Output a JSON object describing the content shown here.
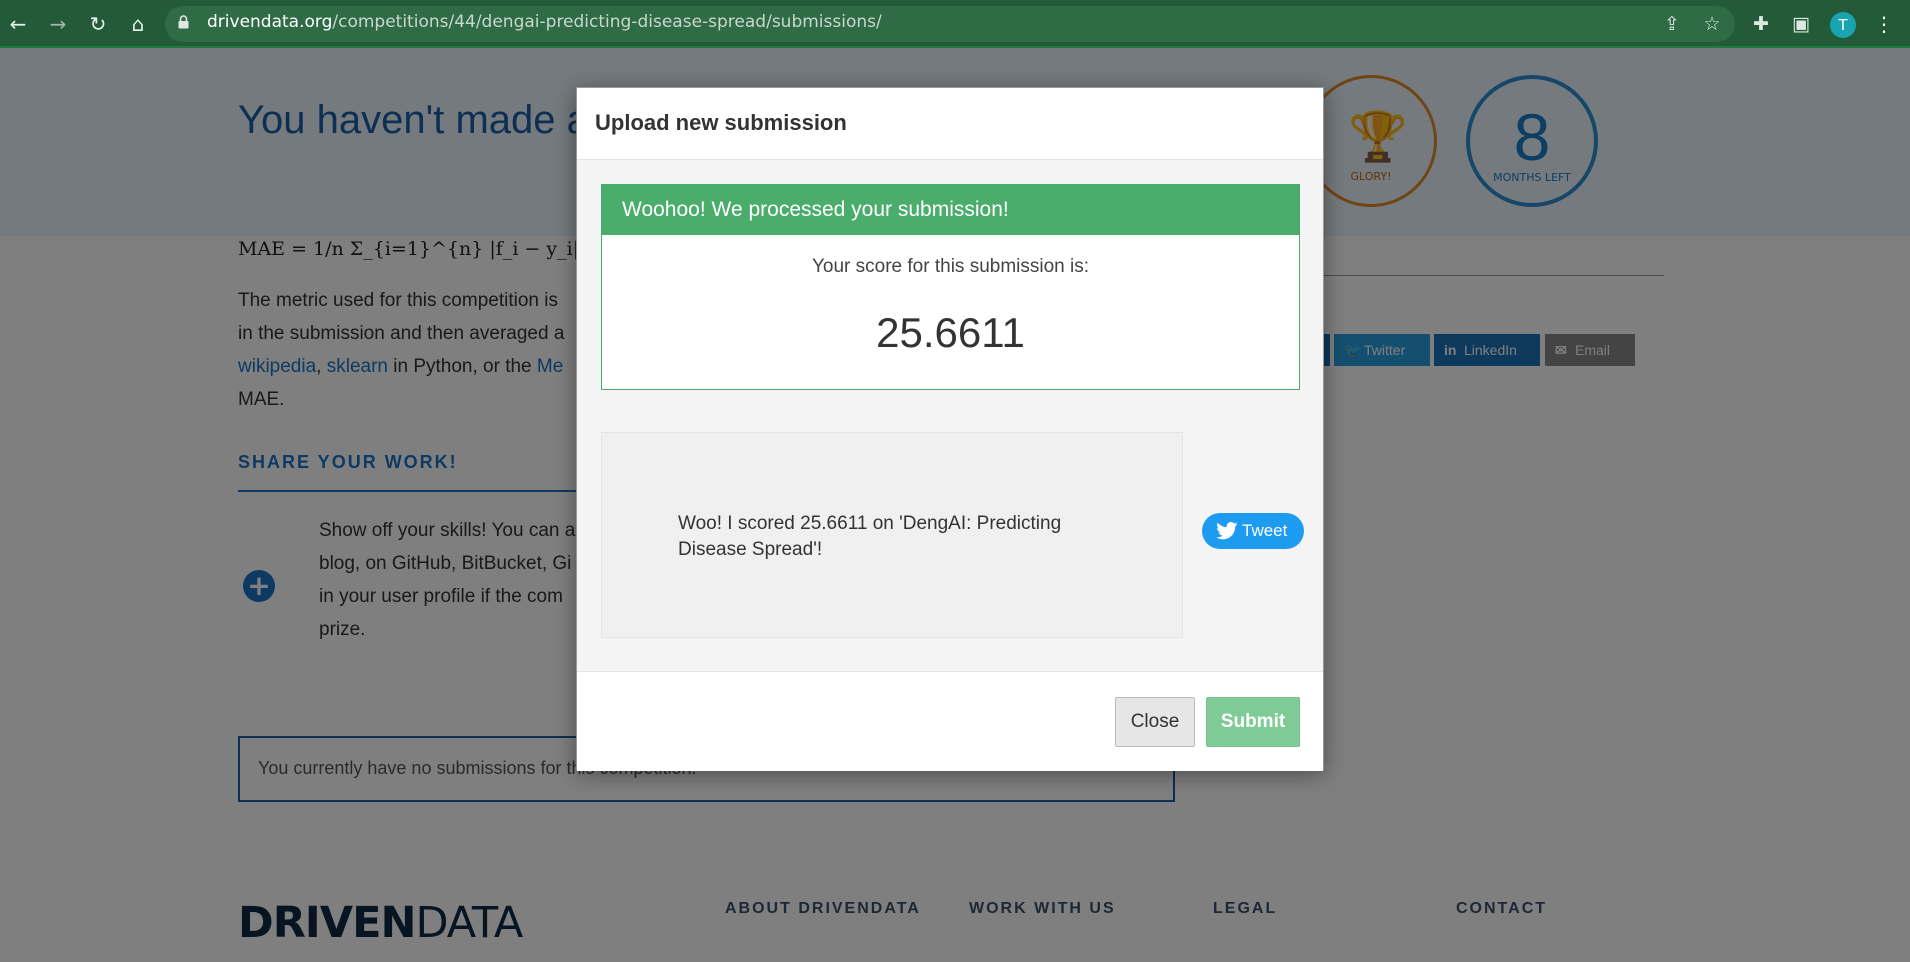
{
  "browser": {
    "url_host": "drivendata.org",
    "url_path": "/competitions/44/dengai-predicting-disease-spread/submissions/",
    "avatar_letter": "T"
  },
  "page": {
    "hero_title": "You haven't made a submission yet. Surely you can do better than that.",
    "hero_title_visible": "You haven't made a do better than that",
    "badge_glory_label": "GLORY!",
    "badge_months_number": "8",
    "badge_months_label": "MONTHS LEFT",
    "formula": "MAE = 1/n Σ_{i=1}^{n} |f_i − y_i|",
    "body_line1": "The metric used for this competition is",
    "body_line2": "in the submission and then averaged a",
    "body_link_wikipedia": "wikipedia",
    "body_link_sklearn": "sklearn",
    "body_line3_mid": " in Python, or the ",
    "body_link_metrics": "Me",
    "body_line4": "MAE.",
    "share_heading": "SHARE YOUR WORK!",
    "share_line1": "Show off your skills! You can a",
    "share_line2": "blog, on GitHub, BitBucket, Gi",
    "share_line3": "in your user profile if the com",
    "share_line4": "prize.",
    "social_twitter": "Twitter",
    "social_linkedin": "LinkedIn",
    "social_email": "Email",
    "no_submissions": "You currently have no submissions for this competition.",
    "footer_logo_driven": "DRIVEN",
    "footer_logo_data": "DATA",
    "footer_links": [
      "ABOUT DRIVENDATA",
      "WORK WITH US",
      "LEGAL",
      "CONTACT"
    ]
  },
  "modal": {
    "title": "Upload new submission",
    "success_heading": "Woohoo! We processed your submission!",
    "score_label": "Your score for this submission is:",
    "score_value": "25.6611",
    "tweet_text": "Woo! I scored 25.6611 on 'DengAI: Predicting Disease Spread'!",
    "tweet_button": "Tweet",
    "close_button": "Close",
    "submit_button": "Submit"
  },
  "colors": {
    "success_green": "#4aad6c",
    "submit_green": "#7fcb98",
    "twitter_blue": "#1d9bf0",
    "brand_blue": "#1a73c4"
  }
}
